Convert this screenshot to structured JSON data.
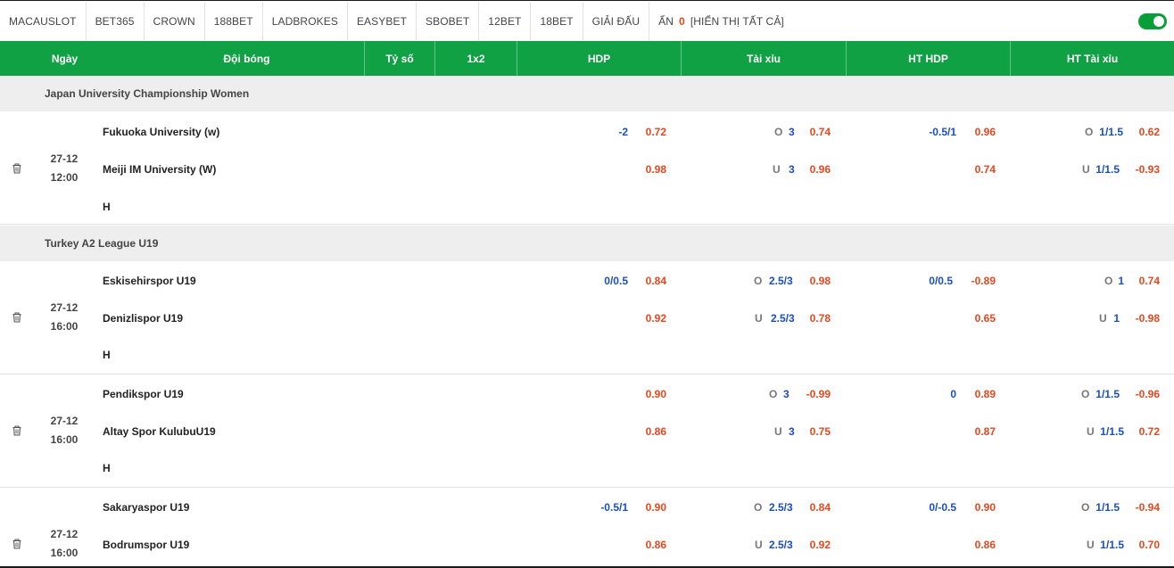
{
  "tabs": [
    "MACAUSLOT",
    "BET365",
    "CROWN",
    "188BET",
    "LADBROKES",
    "EASYBET",
    "SBOBET",
    "12BET",
    "18BET",
    "GIẢI ĐẤU"
  ],
  "hidden": {
    "label": "ẨN",
    "count": "0",
    "show_all": "[HIỂN THỊ TẤT CẢ]"
  },
  "header": {
    "date": "Ngày",
    "teams": "Đội bóng",
    "score": "Tỷ số",
    "x12": "1x2",
    "hdp": "HDP",
    "ou": "Tài xỉu",
    "ht_hdp": "HT HDP",
    "ht_ou": "HT Tài xỉu"
  },
  "leagues": [
    "Japan University Championship Women",
    "Turkey A2 League U19"
  ],
  "matches": [
    {
      "date": "27-12",
      "time": "12:00",
      "home": "Fukuoka University (w)",
      "away": "Meiji IM University (W)",
      "draw": "H",
      "hdp": {
        "line": "-2",
        "home": "0.72",
        "away": "0.98"
      },
      "ou": {
        "o": "O",
        "o_line": "3",
        "o_price": "0.74",
        "u": "U",
        "u_line": "3",
        "u_price": "0.96"
      },
      "ht_hdp": {
        "line": "-0.5/1",
        "home": "0.96",
        "away": "0.74"
      },
      "ht_ou": {
        "o": "O",
        "o_line": "1/1.5",
        "o_price": "0.62",
        "u": "U",
        "u_line": "1/1.5",
        "u_price": "-0.93"
      }
    },
    {
      "date": "27-12",
      "time": "16:00",
      "home": "Eskisehirspor U19",
      "away": "Denizlispor U19",
      "draw": "H",
      "hdp": {
        "line": "0/0.5",
        "home": "0.84",
        "away": "0.92"
      },
      "ou": {
        "o": "O",
        "o_line": "2.5/3",
        "o_price": "0.98",
        "u": "U",
        "u_line": "2.5/3",
        "u_price": "0.78"
      },
      "ht_hdp": {
        "line": "0/0.5",
        "home": "-0.89",
        "away": "0.65"
      },
      "ht_ou": {
        "o": "O",
        "o_line": "1",
        "o_price": "0.74",
        "u": "U",
        "u_line": "1",
        "u_price": "-0.98"
      }
    },
    {
      "date": "27-12",
      "time": "16:00",
      "home": "Pendikspor U19",
      "away": "Altay Spor KulubuU19",
      "draw": "H",
      "hdp": {
        "line": "",
        "home": "0.90",
        "away": "0.86"
      },
      "ou": {
        "o": "O",
        "o_line": "3",
        "o_price": "-0.99",
        "u": "U",
        "u_line": "3",
        "u_price": "0.75"
      },
      "ht_hdp": {
        "line": "0",
        "home": "0.89",
        "away": "0.87"
      },
      "ht_ou": {
        "o": "O",
        "o_line": "1/1.5",
        "o_price": "-0.96",
        "u": "U",
        "u_line": "1/1.5",
        "u_price": "0.72"
      }
    },
    {
      "date": "27-12",
      "time": "16:00",
      "home": "Sakaryaspor U19",
      "away": "Bodrumspor U19",
      "draw": "H",
      "hdp": {
        "line": "-0.5/1",
        "home": "0.90",
        "away": "0.86"
      },
      "ou": {
        "o": "O",
        "o_line": "2.5/3",
        "o_price": "0.84",
        "u": "U",
        "u_line": "2.5/3",
        "u_price": "0.92"
      },
      "ht_hdp": {
        "line": "0/-0.5",
        "home": "0.90",
        "away": "0.86"
      },
      "ht_ou": {
        "o": "O",
        "o_line": "1/1.5",
        "o_price": "-0.94",
        "u": "U",
        "u_line": "1/1.5",
        "u_price": "0.70"
      }
    }
  ],
  "colors": {
    "header_green": "#0fa143",
    "line_blue": "#1a4fbf",
    "price_red": "#e8471d",
    "league_grey": "#eeeeee"
  },
  "icons": {
    "delete": "trash-icon",
    "toggle": "toggle-switch"
  }
}
